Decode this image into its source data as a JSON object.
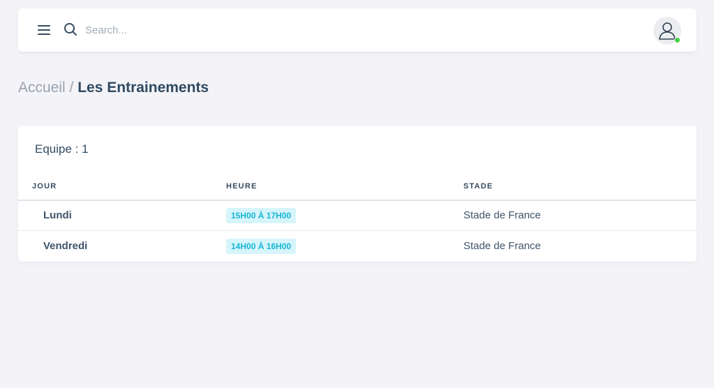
{
  "topbar": {
    "search_placeholder": "Search..."
  },
  "icons": {
    "menu": "menu-icon",
    "search": "search-icon",
    "user": "user-icon"
  },
  "breadcrumb": {
    "home": "Accueil",
    "separator": " / ",
    "current": "Les Entrainements"
  },
  "card": {
    "title": "Equipe : 1"
  },
  "table": {
    "headers": {
      "day": "JOUR",
      "hour": "HEURE",
      "stadium": "STADE"
    },
    "rows": [
      {
        "day": "Lundi",
        "hour": "15H00 À 17H00",
        "stadium": "Stade de France"
      },
      {
        "day": "Vendredi",
        "hour": "14H00 À 16H00",
        "stadium": "Stade de France"
      }
    ]
  },
  "colors": {
    "background": "#f4f4f8",
    "badge_bg": "#d6f5fb",
    "badge_text": "#17b6d6",
    "status_online": "#43d142"
  }
}
